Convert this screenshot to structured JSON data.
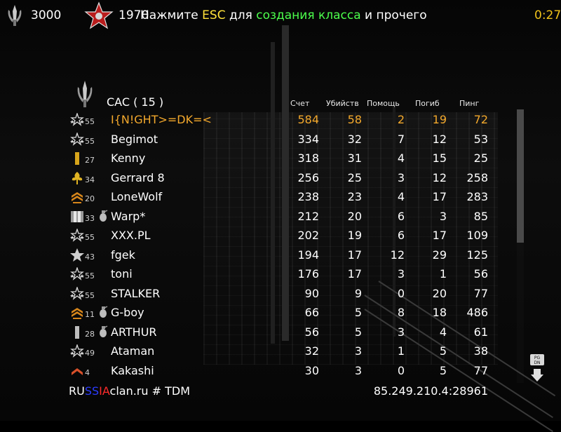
{
  "hud": {
    "left_icon": "knife-emblem-icon",
    "score": "3000",
    "opponent_icon": "red-star-icon",
    "opponent_score": "1970",
    "message_prefix": "Нажмите ",
    "message_key": "ESC",
    "message_mid": " для ",
    "message_action": "создания класса",
    "message_suffix": "  и прочего",
    "timer": "0:27",
    "colors": {
      "key": "#ffe23a",
      "action": "#4cff4c",
      "timer": "#f0c21a"
    }
  },
  "scoreboard": {
    "team_icon": "knife-emblem-icon",
    "team_label": "CAC  ( 15 )",
    "columns": [
      "Счет",
      "Убийств",
      "Помощь",
      "Погиб",
      "Пинг"
    ],
    "highlight_color": "#f4a92c",
    "players": [
      {
        "rank": "55",
        "rank_icon": "star-rank-icon",
        "perk": "",
        "name": "I{N!GHT>=DK=<",
        "score": "584",
        "kills": "58",
        "assists": "2",
        "deaths": "19",
        "ping": "72",
        "highlight": true
      },
      {
        "rank": "55",
        "rank_icon": "star-rank-icon",
        "perk": "",
        "name": "Begimot",
        "score": "334",
        "kills": "32",
        "assists": "7",
        "deaths": "12",
        "ping": "53",
        "highlight": false
      },
      {
        "rank": "27",
        "rank_icon": "gold-bar-rank-icon",
        "perk": "",
        "name": "Kenny",
        "score": "318",
        "kills": "31",
        "assists": "4",
        "deaths": "15",
        "ping": "25",
        "highlight": false
      },
      {
        "rank": "34",
        "rank_icon": "oak-leaf-rank-icon",
        "perk": "",
        "name": "Gerrard  8",
        "score": "256",
        "kills": "25",
        "assists": "3",
        "deaths": "12",
        "ping": "258",
        "highlight": false
      },
      {
        "rank": "20",
        "rank_icon": "sergeant-chevron-rank-icon",
        "perk": "",
        "name": "LoneWolf",
        "score": "238",
        "kills": "23",
        "assists": "4",
        "deaths": "17",
        "ping": "283",
        "highlight": false
      },
      {
        "rank": "33",
        "rank_icon": "double-bar-rank-icon",
        "perk": "grenade-icon",
        "name": "Warp*",
        "score": "212",
        "kills": "20",
        "assists": "6",
        "deaths": "3",
        "ping": "85",
        "highlight": false
      },
      {
        "rank": "55",
        "rank_icon": "star-rank-icon",
        "perk": "",
        "name": "XXX.PL",
        "score": "202",
        "kills": "19",
        "assists": "6",
        "deaths": "17",
        "ping": "109",
        "highlight": false
      },
      {
        "rank": "43",
        "rank_icon": "silver-star-rank-icon",
        "perk": "",
        "name": "fgek",
        "score": "194",
        "kills": "17",
        "assists": "12",
        "deaths": "29",
        "ping": "125",
        "highlight": false
      },
      {
        "rank": "55",
        "rank_icon": "star-rank-icon",
        "perk": "",
        "name": "toni",
        "score": "176",
        "kills": "17",
        "assists": "3",
        "deaths": "1",
        "ping": "56",
        "highlight": false
      },
      {
        "rank": "55",
        "rank_icon": "star-rank-icon",
        "perk": "",
        "name": "STALKER",
        "score": "90",
        "kills": "9",
        "assists": "0",
        "deaths": "20",
        "ping": "77",
        "highlight": false
      },
      {
        "rank": "11",
        "rank_icon": "sergeant-chevron-rank-icon",
        "perk": "grenade-icon",
        "name": "G-boy",
        "score": "66",
        "kills": "5",
        "assists": "8",
        "deaths": "18",
        "ping": "486",
        "highlight": false
      },
      {
        "rank": "28",
        "rank_icon": "silver-bar-rank-icon",
        "perk": "grenade-icon",
        "name": "ARTHUR",
        "score": "56",
        "kills": "5",
        "assists": "3",
        "deaths": "4",
        "ping": "61",
        "highlight": false
      },
      {
        "rank": "49",
        "rank_icon": "star-rank-icon",
        "perk": "",
        "name": "Ataman",
        "score": "32",
        "kills": "3",
        "assists": "1",
        "deaths": "5",
        "ping": "38",
        "highlight": false
      },
      {
        "rank": "4",
        "rank_icon": "private-chevron-rank-icon",
        "perk": "",
        "name": "Kakashi",
        "score": "30",
        "kills": "3",
        "assists": "0",
        "deaths": "5",
        "ping": "77",
        "highlight": false
      }
    ]
  },
  "footer": {
    "server_name_part1": "RU",
    "server_name_part2": "SS",
    "server_name_part3": "IA",
    "server_name_rest": "clan.ru # TDM",
    "server_address": "85.249.210.4:28961",
    "pgdn_icon": "pgdn-arrow-icon",
    "pgdn_label": "PG DN"
  }
}
